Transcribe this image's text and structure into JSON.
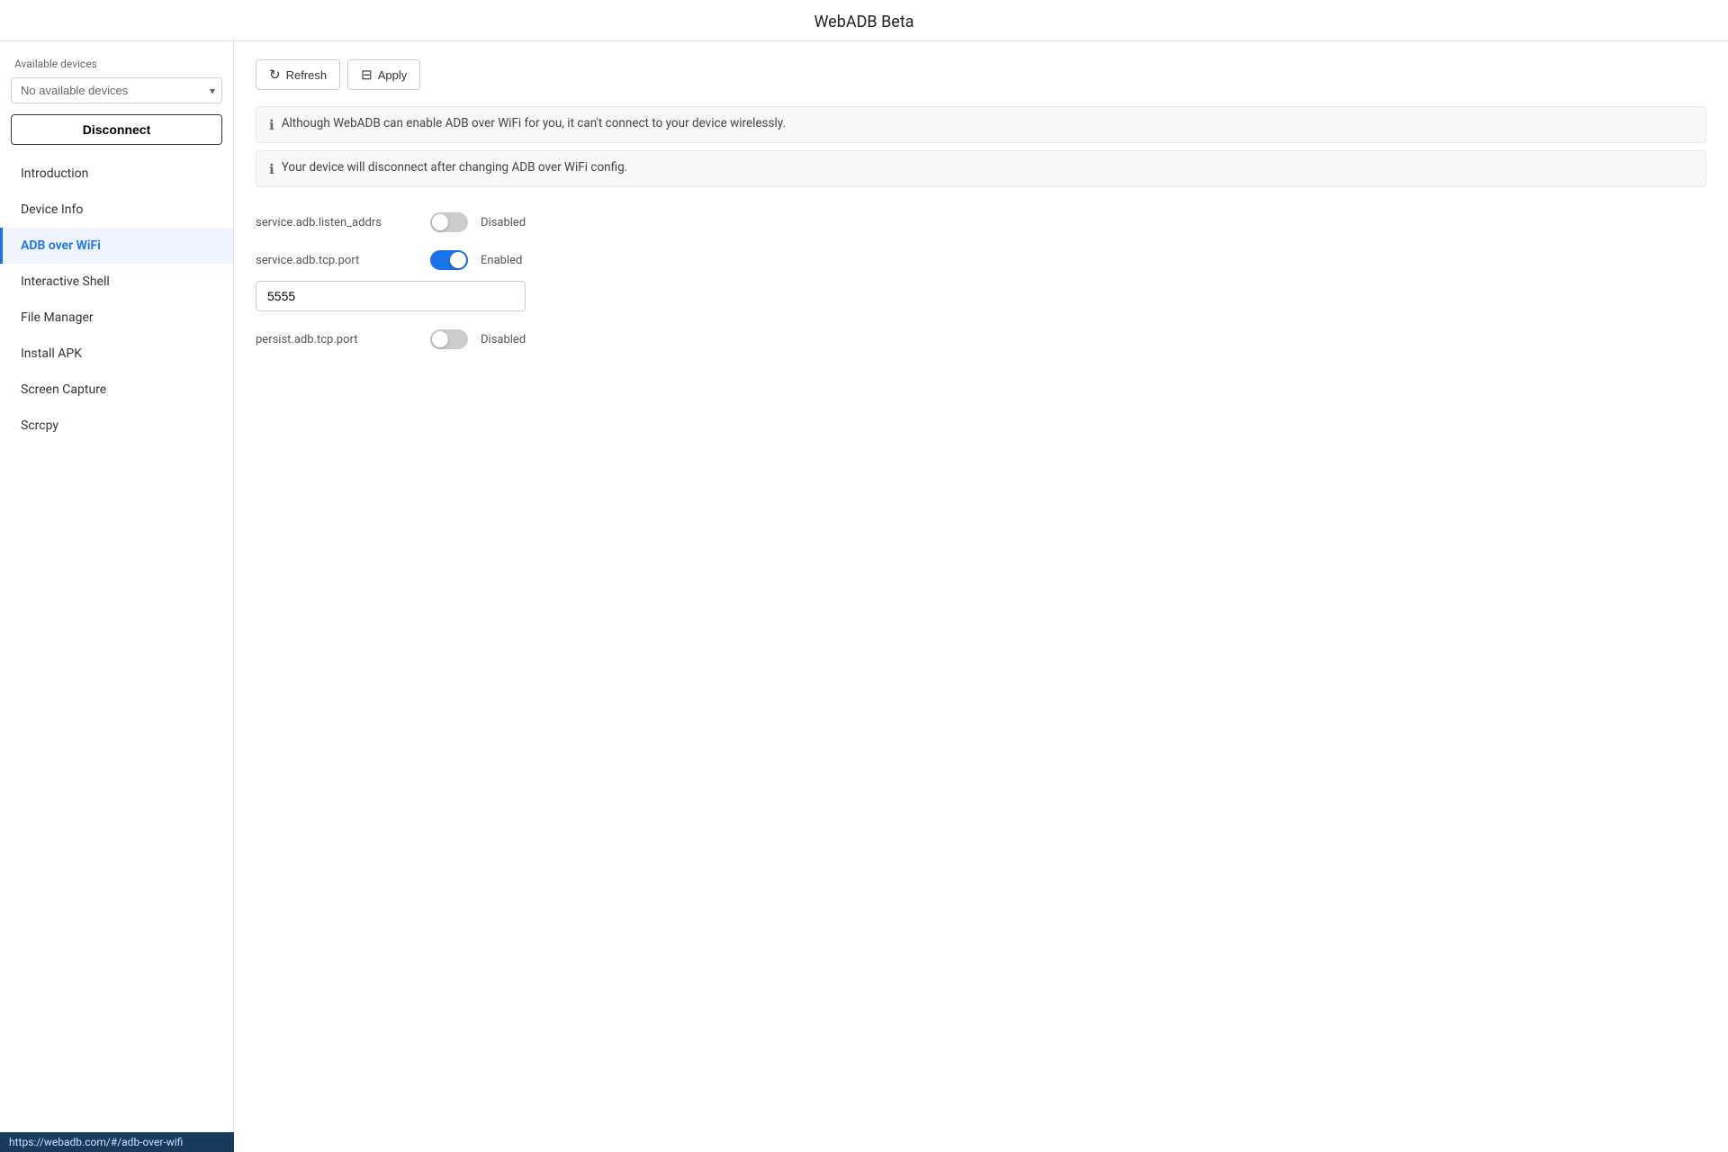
{
  "app": {
    "title": "WebADB Beta"
  },
  "sidebar": {
    "available_devices_label": "Available devices",
    "no_devices_option": "No available devices",
    "disconnect_button": "Disconnect",
    "nav_items": [
      {
        "id": "introduction",
        "label": "Introduction",
        "active": false
      },
      {
        "id": "device-info",
        "label": "Device Info",
        "active": false
      },
      {
        "id": "adb-over-wifi",
        "label": "ADB over WiFi",
        "active": true
      },
      {
        "id": "interactive-shell",
        "label": "Interactive Shell",
        "active": false
      },
      {
        "id": "file-manager",
        "label": "File Manager",
        "active": false
      },
      {
        "id": "install-apk",
        "label": "Install APK",
        "active": false
      },
      {
        "id": "screen-capture",
        "label": "Screen Capture",
        "active": false
      },
      {
        "id": "scrcpy",
        "label": "Scrcpy",
        "active": false
      }
    ]
  },
  "toolbar": {
    "refresh_label": "Refresh",
    "apply_label": "Apply"
  },
  "banners": [
    {
      "text": "Although WebADB can enable ADB over WiFi for you, it can't connect to your device wirelessly."
    },
    {
      "text": "Your device will disconnect after changing ADB over WiFi config."
    }
  ],
  "settings": [
    {
      "id": "listen_addrs",
      "label": "service.adb.listen_addrs",
      "enabled": false,
      "status": "Disabled",
      "has_input": false
    },
    {
      "id": "tcp_port",
      "label": "service.adb.tcp.port",
      "enabled": true,
      "status": "Enabled",
      "has_input": true,
      "input_value": "5555"
    },
    {
      "id": "persist_tcp_port",
      "label": "persist.adb.tcp.port",
      "enabled": false,
      "status": "Disabled",
      "has_input": false
    }
  ],
  "status_bar": {
    "url": "https://webadb.com/#/adb-over-wifi"
  }
}
